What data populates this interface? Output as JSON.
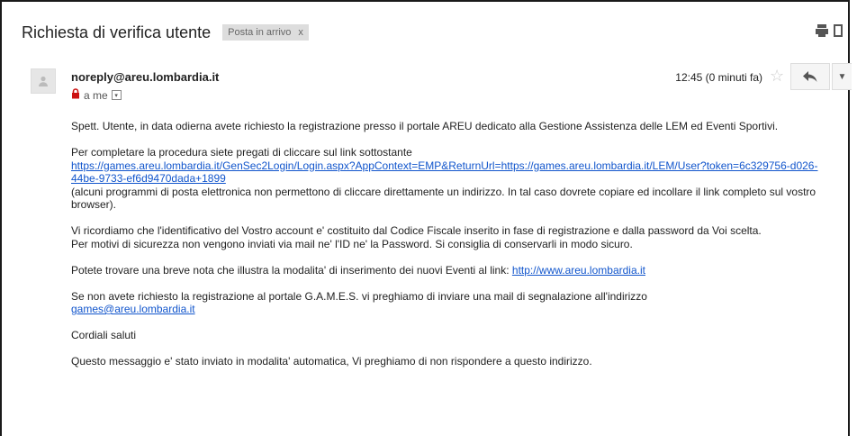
{
  "email": {
    "subject": "Richiesta di verifica utente",
    "label": "Posta in arrivo",
    "label_remove": "x",
    "sender": "noreply@areu.lombardia.it",
    "recipient": "a me",
    "time": "12:45 (0 minuti fa)",
    "body": {
      "p1": "Spett. Utente, in data odierna avete richiesto la registrazione presso il portale AREU dedicato alla Gestione Assistenza delle LEM ed Eventi Sportivi.",
      "p2_intro": "Per completare la procedura siete pregati di cliccare sul link sottostante",
      "p2_link": "https://games.areu.lombardia.it/GenSec2Login/Login.aspx?AppContext=EMP&ReturnUrl=https://games.areu.lombardia.it/LEM/User?token=6c329756-d026-44be-9733-ef6d9470dada+1899",
      "p2_note": "(alcuni programmi di posta elettronica non permettono di cliccare direttamente un indirizzo. In tal caso dovrete copiare ed incollare il link completo sul vostro browser).",
      "p3_a": "Vi ricordiamo che l'identificativo del Vostro account e' costituito dal Codice Fiscale inserito in fase di registrazione e dalla password da Voi scelta.",
      "p3_b": "Per motivi di sicurezza non vengono inviati via mail ne' l'ID ne' la Password. Si consiglia di conservarli in modo sicuro.",
      "p4_text": "Potete trovare una breve nota che illustra la modalita' di inserimento dei nuovi Eventi al link: ",
      "p4_link": "http://www.areu.lombardia.it",
      "p5_text": "Se non avete richiesto la registrazione al portale G.A.M.E.S. vi preghiamo di inviare una mail di segnalazione all'indirizzo",
      "p5_link": "games@areu.lombardia.it",
      "p6": "Cordiali saluti",
      "p7": "Questo messaggio e' stato inviato in modalita' automatica, Vi preghiamo di non rispondere a questo indirizzo."
    }
  },
  "icons": {
    "print": "print-icon",
    "new_window": "new-window-icon",
    "avatar": "person-icon",
    "lock": "lock-icon",
    "star": "star-icon",
    "reply": "reply-icon",
    "more": "chevron-down-icon"
  },
  "colors": {
    "link": "#1155cc",
    "lock": "#cc1111",
    "label_bg": "#dddddd"
  }
}
